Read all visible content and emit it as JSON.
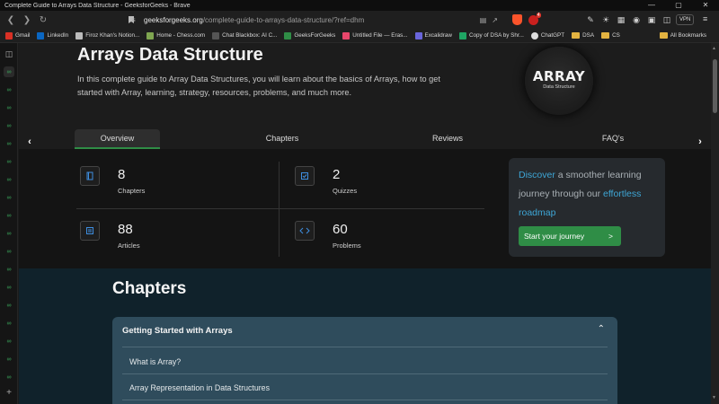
{
  "window": {
    "title": "Complete Guide to Arrays Data Structure - GeeksforGeeks - Brave",
    "controls": [
      "—",
      "▢",
      "✕"
    ]
  },
  "address": {
    "host": "geeksforgeeks.org",
    "path": "/complete-guide-to-arrays-data-structure/?ref=dhm",
    "rewards_badge": "4",
    "vpn_label": "VPN"
  },
  "bookmarks": [
    {
      "label": "Gmail",
      "color": "#d93025"
    },
    {
      "label": "LinkedIn",
      "color": "#0a66c2"
    },
    {
      "label": "Firoz Khan's Notion...",
      "color": "#bbbbbb"
    },
    {
      "label": "Home - Chess.com",
      "color": "#7fa650"
    },
    {
      "label": "Chat Blackbox: AI C...",
      "color": "#333333"
    },
    {
      "label": "GeeksForGeeks",
      "color": "#2f8d46"
    },
    {
      "label": "Untitled File — Eras...",
      "color": "#e8466b"
    },
    {
      "label": "Excalidraw",
      "color": "#6965db"
    },
    {
      "label": "Copy of DSA by Shr...",
      "color": "#1fa463"
    },
    {
      "label": "ChatGPT",
      "color": "#dddddd"
    },
    {
      "label": "DSA",
      "color": "folder"
    },
    {
      "label": "CS",
      "color": "folder"
    }
  ],
  "all_bookmarks": "All Bookmarks",
  "hero": {
    "title": "Arrays Data Structure",
    "description": "In this complete guide to Array Data Structures, you will learn about the basics of Arrays, how to get started with Array, learning, strategy, resources, problems, and much more.",
    "logo_big": "ARRAY",
    "logo_small": "Data Structure"
  },
  "tabs": [
    "Overview",
    "Chapters",
    "Reviews",
    "FAQ's"
  ],
  "stats": [
    {
      "value": "8",
      "label": "Chapters",
      "icon": "book-icon"
    },
    {
      "value": "2",
      "label": "Quizzes",
      "icon": "quiz-icon"
    },
    {
      "value": "88",
      "label": "Articles",
      "icon": "article-icon"
    },
    {
      "value": "60",
      "label": "Problems",
      "icon": "code-icon"
    }
  ],
  "promo": {
    "w1": "Discover",
    "t1": " a smoother learning journey through our ",
    "w2": "effortless roadmap",
    "button": "Start your journey",
    "button_arrow": ">",
    "highlight_color": "#3ea6d6"
  },
  "chapters": {
    "heading": "Chapters",
    "accordion_title": "Getting Started with Arrays",
    "items": [
      "What is Array?",
      "Array Representation in Data Structures"
    ]
  },
  "colors": {
    "accent_green": "#2f8d46",
    "accordion_bg": "#2f4c5c",
    "chapters_bg": "#10222b"
  }
}
